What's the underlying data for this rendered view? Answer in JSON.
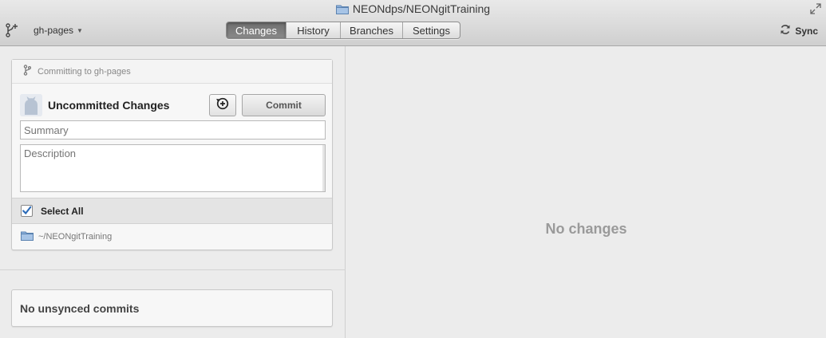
{
  "window": {
    "title": "NEONdps/NEONgitTraining"
  },
  "toolbar": {
    "branch": "gh-pages",
    "tabs": [
      {
        "label": "Changes",
        "active": true
      },
      {
        "label": "History",
        "active": false
      },
      {
        "label": "Branches",
        "active": false
      },
      {
        "label": "Settings",
        "active": false
      }
    ],
    "sync_label": "Sync"
  },
  "commit_panel": {
    "committing_to": "Committing to gh-pages",
    "heading": "Uncommitted Changes",
    "commit_button": "Commit",
    "summary_placeholder": "Summary",
    "description_placeholder": "Description",
    "select_all_label": "Select All",
    "select_all_checked": true,
    "repo_path": "~/NEONgitTraining"
  },
  "unsynced": {
    "label": "No unsynced commits"
  },
  "main": {
    "empty_message": "No changes"
  },
  "colors": {
    "accent_checkbox": "#2a6ab8",
    "active_tab": "#777777",
    "folder_blue": "#7ea7d6"
  }
}
